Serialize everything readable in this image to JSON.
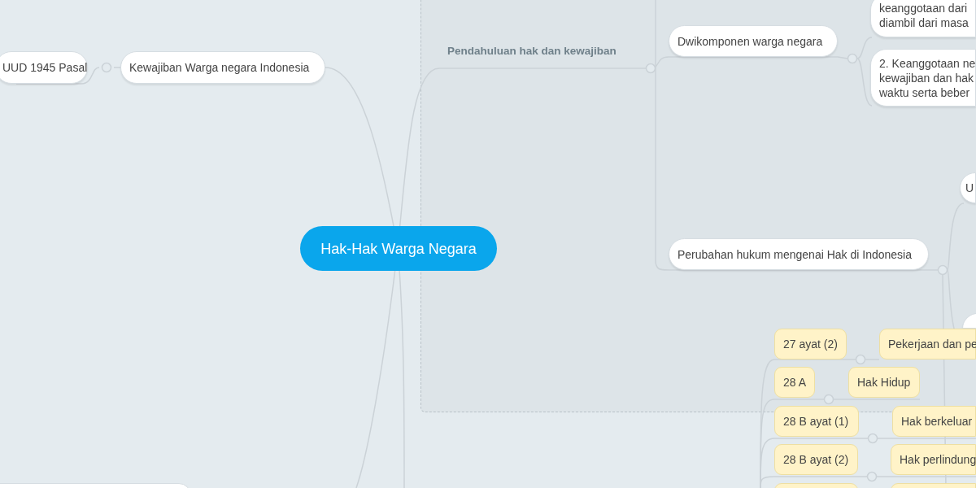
{
  "group": {
    "title": "Pendahuluan hak dan kewajiban"
  },
  "nodes": [
    {
      "kind": "central",
      "lines": [
        "Hak-Hak Warga Negara"
      ]
    },
    {
      "kind": "white",
      "lines": [
        "UUD 1945 Pasal"
      ]
    },
    {
      "kind": "white",
      "lines": [
        "Kewajiban Warga negara Indonesia"
      ]
    },
    {
      "kind": "white",
      "lines": [
        "Dwikomponen warga negara"
      ]
    },
    {
      "kind": "white",
      "lines": [
        "keanggotaan dari",
        "diambil dari masa"
      ]
    },
    {
      "kind": "white",
      "lines": [
        "2. Keanggotaan ne",
        "kewajiban dan hak",
        "waktu serta beber"
      ]
    },
    {
      "kind": "white",
      "lines": [
        "Perubahan hukum mengenai Hak di Indonesia"
      ]
    },
    {
      "kind": "white",
      "lines": [
        "U"
      ]
    },
    {
      "kind": "white"
    },
    {
      "kind": "yellow",
      "lines": [
        "27 ayat (2)"
      ]
    },
    {
      "kind": "yellow",
      "lines": [
        "Pekerjaan dan pe"
      ]
    },
    {
      "kind": "yellow",
      "lines": [
        "28 A"
      ]
    },
    {
      "kind": "yellow",
      "lines": [
        "Hak Hidup"
      ]
    },
    {
      "kind": "yellow",
      "lines": [
        "28 B  ayat (1)"
      ]
    },
    {
      "kind": "yellow",
      "lines": [
        "Hak berkeluar"
      ]
    },
    {
      "kind": "yellow",
      "lines": [
        "28 B ayat (2)"
      ]
    },
    {
      "kind": "yellow",
      "lines": [
        "Hak perlindung"
      ]
    },
    {
      "kind": "yellow"
    },
    {
      "kind": "yellow"
    },
    {
      "kind": "white"
    }
  ]
}
